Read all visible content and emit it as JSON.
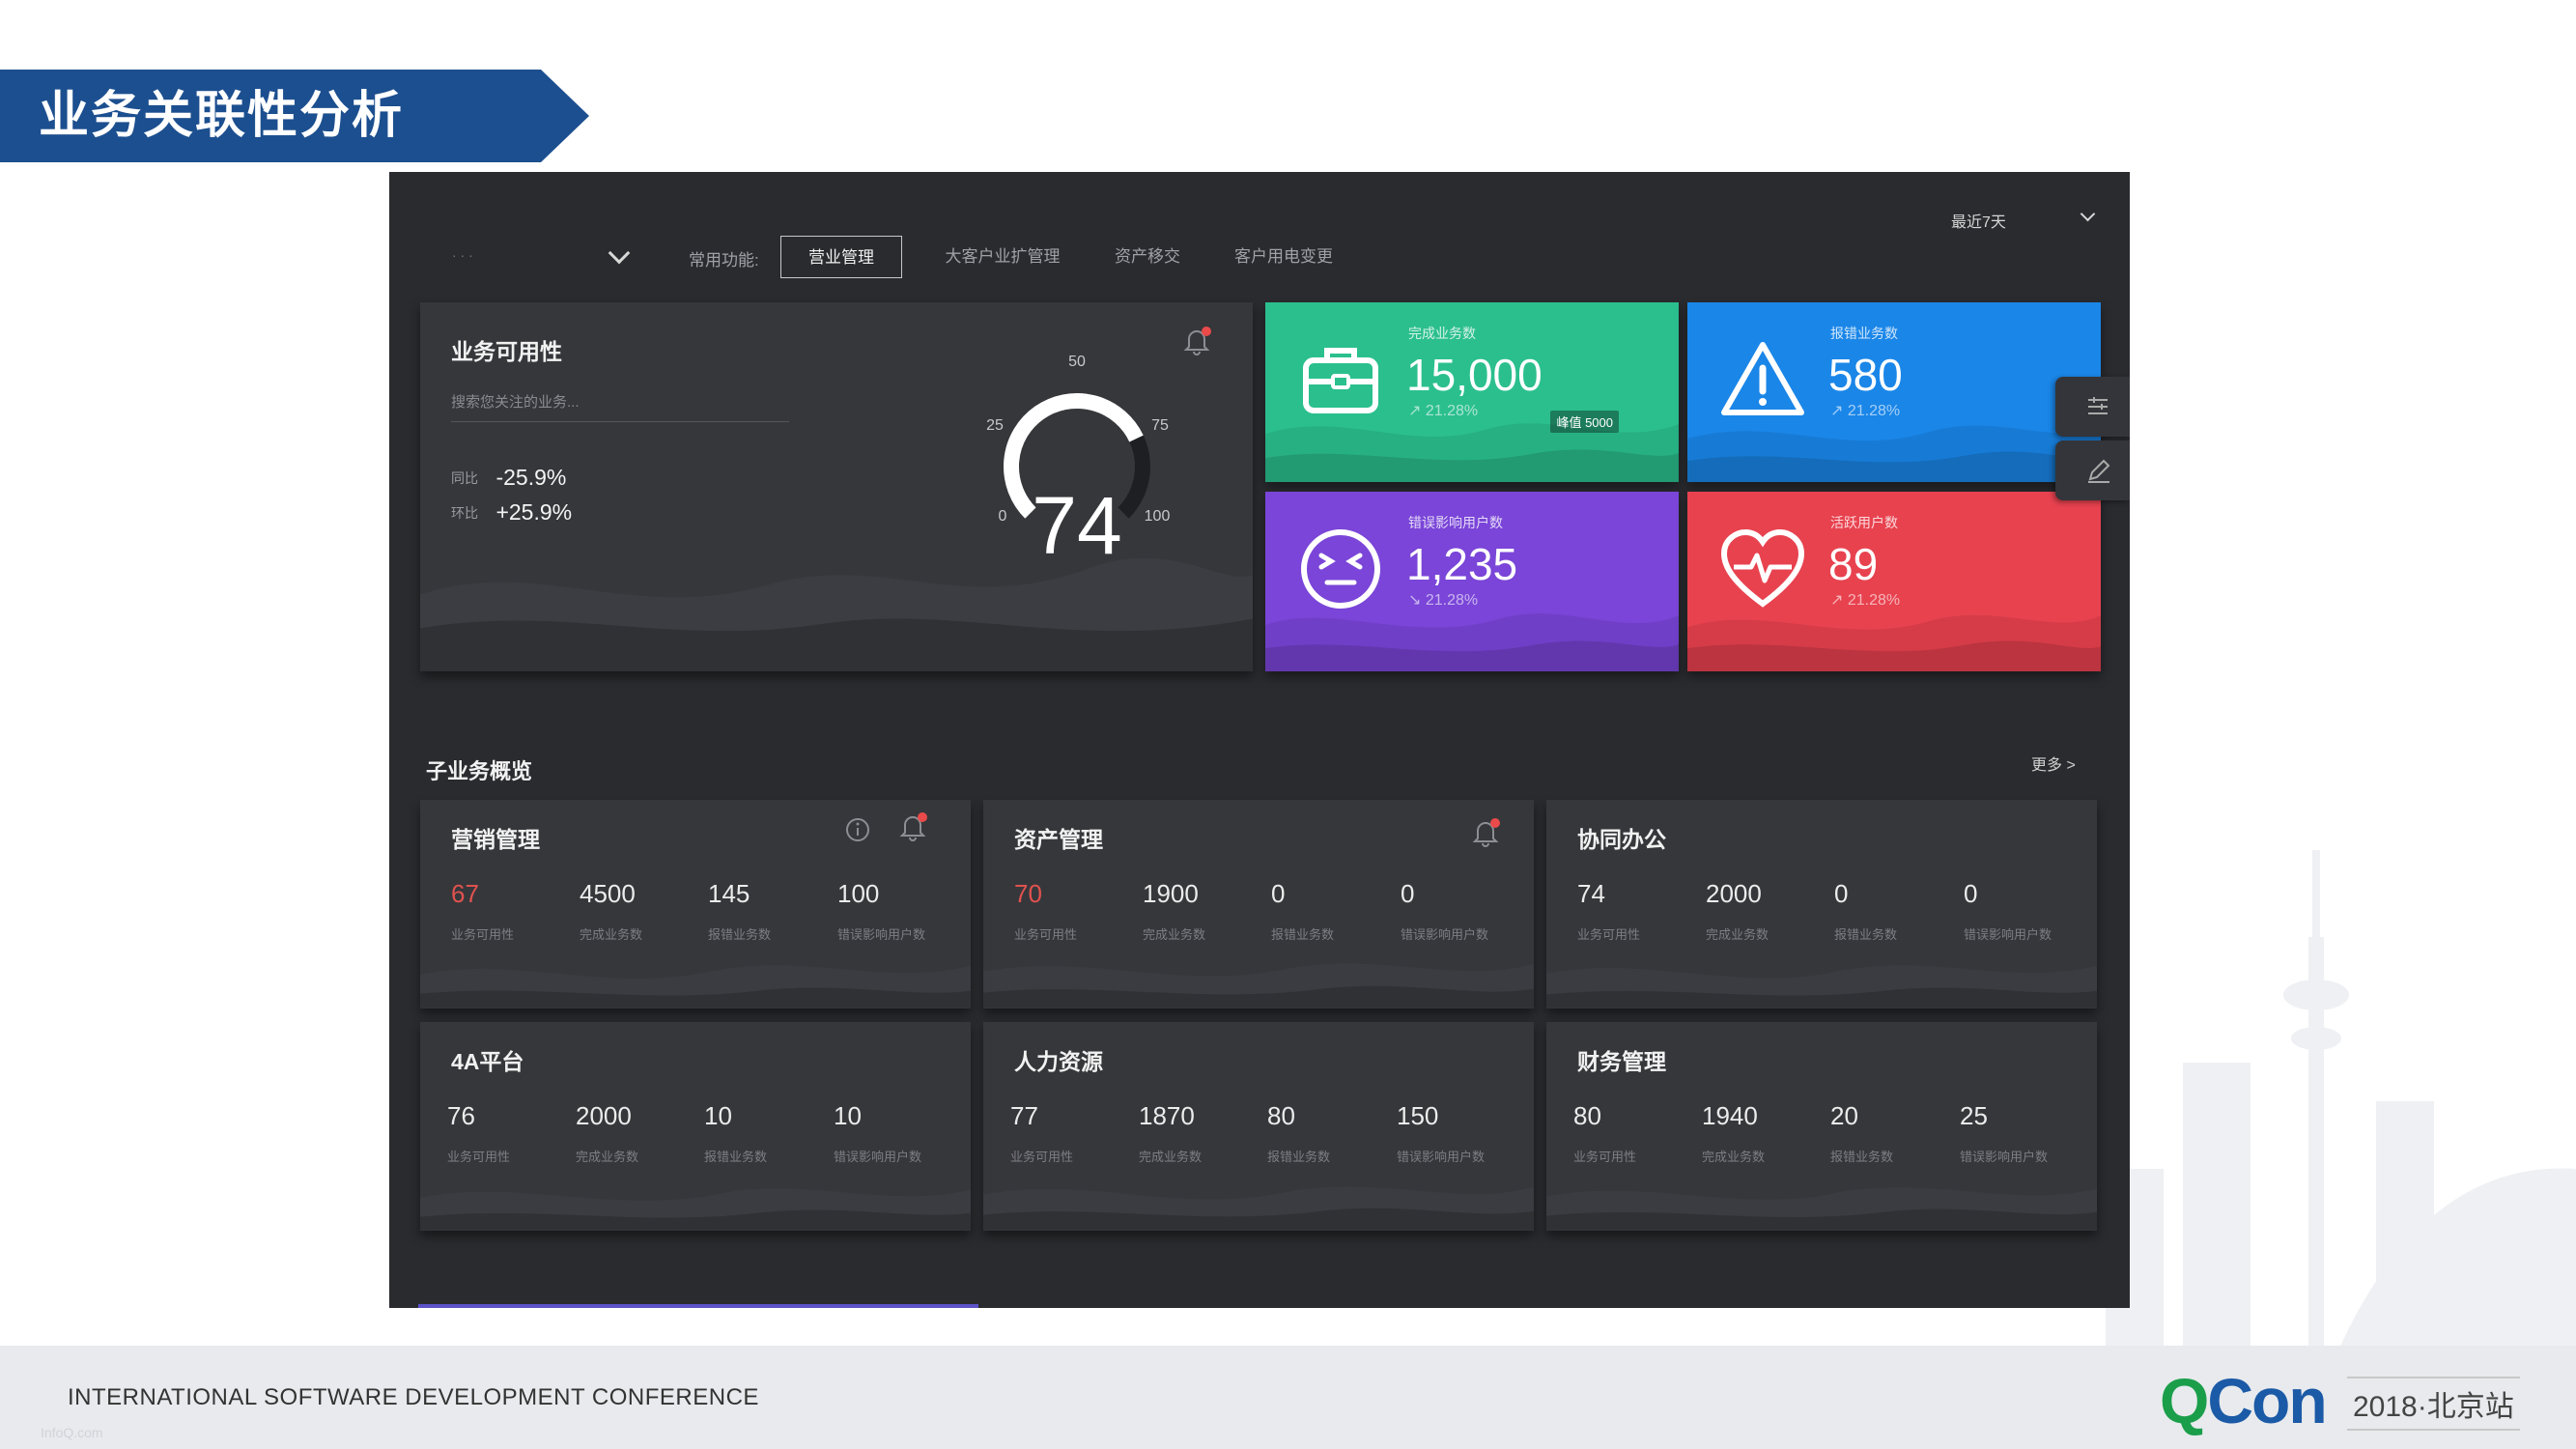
{
  "slide": {
    "title": "业务关联性分析",
    "footer_text": "INTERNATIONAL SOFTWARE DEVELOPMENT CONFERENCE",
    "footer_faint": "InfoQ.com",
    "logo_q": "Q",
    "logo_con": "Con",
    "logo_event": "2018·北京站"
  },
  "dashboard": {
    "top_select_value": "·    ·   ·",
    "common_label": "常用功能:",
    "func_tabs": [
      {
        "label": "营业管理",
        "active": true
      },
      {
        "label": "大客户业扩管理",
        "active": false
      },
      {
        "label": "资产移交",
        "active": false
      },
      {
        "label": "客户用电变更",
        "active": false
      }
    ],
    "range_select": "最近7天",
    "availability": {
      "title": "业务可用性",
      "search_placeholder": "搜索您关注的业务...",
      "yoy_label": "同比",
      "yoy_value": "-25.9%",
      "mom_label": "环比",
      "mom_value": "+25.9%",
      "gauge": {
        "value": "74",
        "min": "0",
        "max": "100",
        "ticks": {
          "t25": "25",
          "t50": "50",
          "t75": "75"
        },
        "fraction": 0.74
      }
    },
    "kpis": [
      {
        "label": "完成业务数",
        "value": "15,000",
        "trend": "↗ 21.28%",
        "peak": "峰值 5000",
        "color": "#2bbf8e",
        "icon": "briefcase-icon"
      },
      {
        "label": "报错业务数",
        "value": "580",
        "trend": "↗ 21.28%",
        "peak": "",
        "color": "#1a86e8",
        "icon": "warning-icon"
      },
      {
        "label": "错误影响用户数",
        "value": "1,235",
        "trend": "↘ 21.28%",
        "peak": "",
        "color": "#7a45d8",
        "icon": "face-icon"
      },
      {
        "label": "活跃用户数",
        "value": "89",
        "trend": "↗ 21.28%",
        "peak": "",
        "color": "#e8424f",
        "icon": "heartbeat-icon"
      }
    ],
    "section": {
      "title": "子业务概览",
      "more": "更多  >"
    },
    "metric_labels": [
      "业务可用性",
      "完成业务数",
      "报错业务数",
      "错误影响用户数"
    ],
    "subs": [
      {
        "title": "营销管理",
        "values": [
          "67",
          "4500",
          "145",
          "100"
        ],
        "warn": true
      },
      {
        "title": "资产管理",
        "values": [
          "70",
          "1900",
          "0",
          "0"
        ],
        "warn": true
      },
      {
        "title": "协同办公",
        "values": [
          "74",
          "2000",
          "0",
          "0"
        ],
        "warn": false
      },
      {
        "title": "4A平台",
        "values": [
          "76",
          "2000",
          "10",
          "10"
        ],
        "warn": false
      },
      {
        "title": "人力资源",
        "values": [
          "77",
          "1870",
          "80",
          "150"
        ],
        "warn": false
      },
      {
        "title": "财务管理",
        "values": [
          "80",
          "1940",
          "20",
          "25"
        ],
        "warn": false
      }
    ]
  }
}
